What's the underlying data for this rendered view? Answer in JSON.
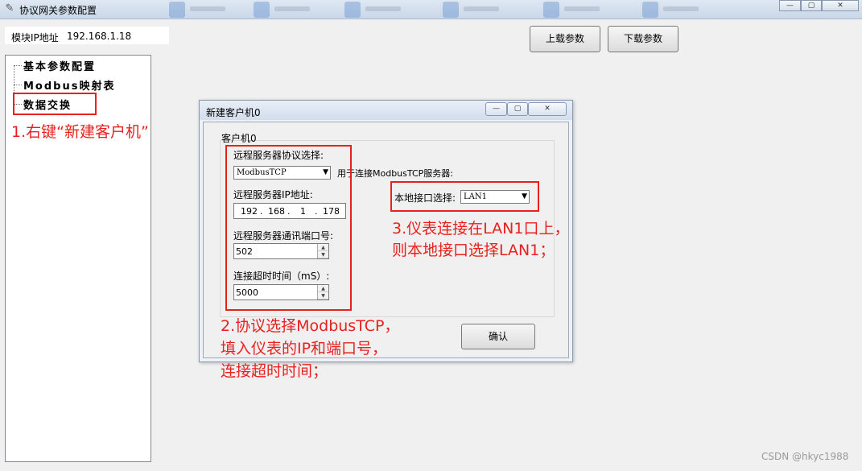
{
  "window": {
    "title": "协议网关参数配置",
    "icon": "wrench-icon",
    "controls": {
      "minimize": "—",
      "maximize": "▢",
      "close": "✕"
    }
  },
  "toolbar": {
    "ip_label": "模块IP地址",
    "ip_value": "192.168.1.18",
    "upload_label": "上载参数",
    "download_label": "下载参数"
  },
  "tree": {
    "items": [
      {
        "label": "基本参数配置"
      },
      {
        "label": "Modbus映射表"
      },
      {
        "label": "数据交换"
      }
    ]
  },
  "dialog": {
    "title": "新建客户机0",
    "controls": {
      "minimize": "—",
      "maximize": "▢",
      "close": "✕"
    },
    "group_label": "客户机0",
    "protocol_label": "远程服务器协议选择:",
    "protocol_value": "ModbusTCP",
    "protocol_hint": "用于连接ModbusTCP服务器:",
    "local_if_label": "本地接口选择:",
    "local_if_value": "LAN1",
    "server_ip_label": "远程服务器IP地址:",
    "server_ip": [
      "192",
      "168",
      "1",
      "178"
    ],
    "port_label": "远程服务器通讯端口号:",
    "port_value": "502",
    "timeout_label": "连接超时时间（mS）:",
    "timeout_value": "5000",
    "ok_label": "确认"
  },
  "annotations": {
    "step1": "1.右键“新建客户机”",
    "step2_line1": "2.协议选择ModbusTCP，",
    "step2_line2": "填入仪表的IP和端口号，",
    "step2_line3": "连接超时时间；",
    "step3_line1": "3.仪表连接在LAN1口上，",
    "step3_line2": "则本地接口选择LAN1；",
    "color": "#e8211f"
  },
  "watermark": "CSDN @hkyc1988"
}
